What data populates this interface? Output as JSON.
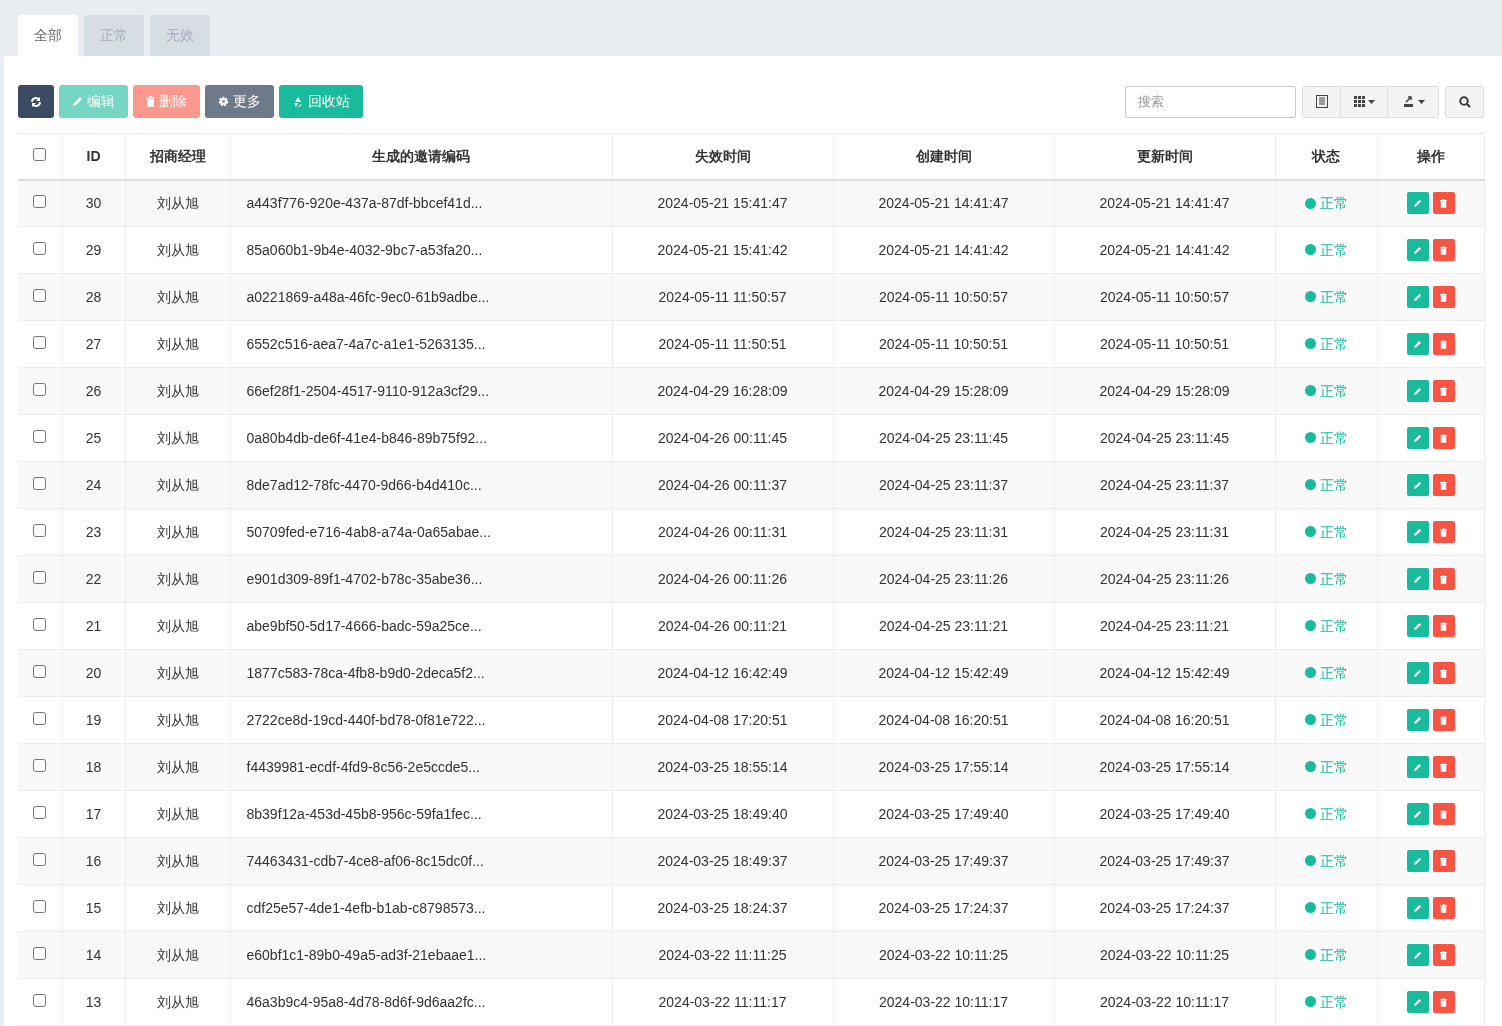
{
  "tabs": [
    {
      "label": "全部",
      "selected": true
    },
    {
      "label": "正常",
      "selected": false
    },
    {
      "label": "无效",
      "selected": false
    }
  ],
  "toolbar": [
    {
      "kind": "refresh",
      "disabled": false
    },
    {
      "kind": "edit",
      "label": "编辑",
      "disabled": true
    },
    {
      "kind": "delete",
      "label": "删除",
      "disabled": true
    },
    {
      "kind": "more",
      "label": "更多",
      "disabled": false
    },
    {
      "kind": "recycle",
      "label": "回收站",
      "disabled": false
    }
  ],
  "search": {
    "placeholder": "搜索"
  },
  "table": {
    "select_all_checked": false,
    "columns": [
      "ID",
      "招商经理",
      "生成的邀请编码",
      "失效时间",
      "创建时间",
      "更新时间",
      "状态",
      "操作"
    ],
    "rows": [
      {
        "checked": false,
        "id": "30",
        "manager": "刘从旭",
        "code": "a443f776-920e-437a-87df-bbcef41d...",
        "expires": "2024-05-21 15:41:47",
        "created": "2024-05-21 14:41:47",
        "updated": "2024-05-21 14:41:47",
        "status": "正常"
      },
      {
        "checked": false,
        "id": "29",
        "manager": "刘从旭",
        "code": "85a060b1-9b4e-4032-9bc7-a53fa20...",
        "expires": "2024-05-21 15:41:42",
        "created": "2024-05-21 14:41:42",
        "updated": "2024-05-21 14:41:42",
        "status": "正常"
      },
      {
        "checked": false,
        "id": "28",
        "manager": "刘从旭",
        "code": "a0221869-a48a-46fc-9ec0-61b9adbe...",
        "expires": "2024-05-11 11:50:57",
        "created": "2024-05-11 10:50:57",
        "updated": "2024-05-11 10:50:57",
        "status": "正常"
      },
      {
        "checked": false,
        "id": "27",
        "manager": "刘从旭",
        "code": "6552c516-aea7-4a7c-a1e1-5263135...",
        "expires": "2024-05-11 11:50:51",
        "created": "2024-05-11 10:50:51",
        "updated": "2024-05-11 10:50:51",
        "status": "正常"
      },
      {
        "checked": false,
        "id": "26",
        "manager": "刘从旭",
        "code": "66ef28f1-2504-4517-9110-912a3cf29...",
        "expires": "2024-04-29 16:28:09",
        "created": "2024-04-29 15:28:09",
        "updated": "2024-04-29 15:28:09",
        "status": "正常"
      },
      {
        "checked": false,
        "id": "25",
        "manager": "刘从旭",
        "code": "0a80b4db-de6f-41e4-b846-89b75f92...",
        "expires": "2024-04-26 00:11:45",
        "created": "2024-04-25 23:11:45",
        "updated": "2024-04-25 23:11:45",
        "status": "正常"
      },
      {
        "checked": false,
        "id": "24",
        "manager": "刘从旭",
        "code": "8de7ad12-78fc-4470-9d66-b4d410c...",
        "expires": "2024-04-26 00:11:37",
        "created": "2024-04-25 23:11:37",
        "updated": "2024-04-25 23:11:37",
        "status": "正常"
      },
      {
        "checked": false,
        "id": "23",
        "manager": "刘从旭",
        "code": "50709fed-e716-4ab8-a74a-0a65abae...",
        "expires": "2024-04-26 00:11:31",
        "created": "2024-04-25 23:11:31",
        "updated": "2024-04-25 23:11:31",
        "status": "正常"
      },
      {
        "checked": false,
        "id": "22",
        "manager": "刘从旭",
        "code": "e901d309-89f1-4702-b78c-35abe36...",
        "expires": "2024-04-26 00:11:26",
        "created": "2024-04-25 23:11:26",
        "updated": "2024-04-25 23:11:26",
        "status": "正常"
      },
      {
        "checked": false,
        "id": "21",
        "manager": "刘从旭",
        "code": "abe9bf50-5d17-4666-badc-59a25ce...",
        "expires": "2024-04-26 00:11:21",
        "created": "2024-04-25 23:11:21",
        "updated": "2024-04-25 23:11:21",
        "status": "正常"
      },
      {
        "checked": false,
        "id": "20",
        "manager": "刘从旭",
        "code": "1877c583-78ca-4fb8-b9d0-2deca5f2...",
        "expires": "2024-04-12 16:42:49",
        "created": "2024-04-12 15:42:49",
        "updated": "2024-04-12 15:42:49",
        "status": "正常"
      },
      {
        "checked": false,
        "id": "19",
        "manager": "刘从旭",
        "code": "2722ce8d-19cd-440f-bd78-0f81e722...",
        "expires": "2024-04-08 17:20:51",
        "created": "2024-04-08 16:20:51",
        "updated": "2024-04-08 16:20:51",
        "status": "正常"
      },
      {
        "checked": false,
        "id": "18",
        "manager": "刘从旭",
        "code": "f4439981-ecdf-4fd9-8c56-2e5ccde5...",
        "expires": "2024-03-25 18:55:14",
        "created": "2024-03-25 17:55:14",
        "updated": "2024-03-25 17:55:14",
        "status": "正常"
      },
      {
        "checked": false,
        "id": "17",
        "manager": "刘从旭",
        "code": "8b39f12a-453d-45b8-956c-59fa1fec...",
        "expires": "2024-03-25 18:49:40",
        "created": "2024-03-25 17:49:40",
        "updated": "2024-03-25 17:49:40",
        "status": "正常"
      },
      {
        "checked": false,
        "id": "16",
        "manager": "刘从旭",
        "code": "74463431-cdb7-4ce8-af06-8c15dc0f...",
        "expires": "2024-03-25 18:49:37",
        "created": "2024-03-25 17:49:37",
        "updated": "2024-03-25 17:49:37",
        "status": "正常"
      },
      {
        "checked": false,
        "id": "15",
        "manager": "刘从旭",
        "code": "cdf25e57-4de1-4efb-b1ab-c8798573...",
        "expires": "2024-03-25 18:24:37",
        "created": "2024-03-25 17:24:37",
        "updated": "2024-03-25 17:24:37",
        "status": "正常"
      },
      {
        "checked": false,
        "id": "14",
        "manager": "刘从旭",
        "code": "e60bf1c1-89b0-49a5-ad3f-21ebaae1...",
        "expires": "2024-03-22 11:11:25",
        "created": "2024-03-22 10:11:25",
        "updated": "2024-03-22 10:11:25",
        "status": "正常"
      },
      {
        "checked": false,
        "id": "13",
        "manager": "刘从旭",
        "code": "46a3b9c4-95a8-4d78-8d6f-9d6aa2fc...",
        "expires": "2024-03-22 11:11:17",
        "created": "2024-03-22 10:11:17",
        "updated": "2024-03-22 10:11:17",
        "status": "正常"
      }
    ]
  }
}
